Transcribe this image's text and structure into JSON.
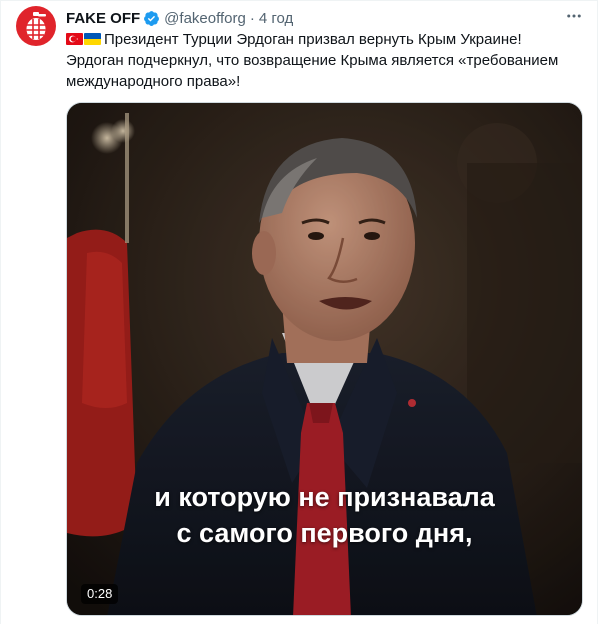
{
  "account": {
    "display_name": "FAKE OFF",
    "handle": "@fakeofforg",
    "separator": "·",
    "time": "4 год",
    "avatar_icon": "grenade-icon",
    "verified_icon": "verified-badge-icon"
  },
  "tweet": {
    "flags": [
      "turkey-flag-icon",
      "ukraine-flag-icon"
    ],
    "line1": "Президент Турции Эрдоган призвал вернуть Крым Украине!",
    "line2": "Эрдоган подчеркнул, что возвращение Крыма является «требованием международного права»!"
  },
  "media": {
    "subtitle_line1": "и которую не признавала",
    "subtitle_line2": "с самого первого дня,",
    "duration": "0:28"
  },
  "colors": {
    "brand_red": "#e0242b",
    "verified_blue": "#1d9bf0",
    "muted_text": "#536471"
  }
}
